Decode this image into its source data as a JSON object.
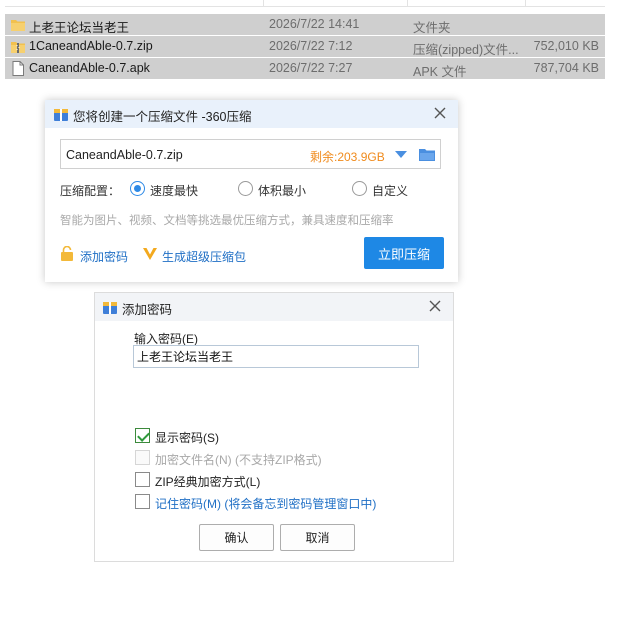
{
  "explorer": {
    "files": [
      {
        "name": "上老王论坛当老王",
        "date": "2026/7/22 14:41",
        "type": "文件夹",
        "size": "",
        "icon": "folder-icon",
        "selected": true
      },
      {
        "name": "1CaneandAble-0.7.zip",
        "date": "2026/7/22 7:12",
        "type": "压缩(zipped)文件...",
        "size": "752,010 KB",
        "icon": "zip-folder-icon",
        "selected": true
      },
      {
        "name": "CaneandAble-0.7.apk",
        "date": "2026/7/22 7:27",
        "type": "APK 文件",
        "size": "787,704 KB",
        "icon": "document-icon",
        "selected": true
      }
    ]
  },
  "compress_dialog": {
    "title": "您将创建一个压缩文件 -360压缩",
    "filename": "CaneandAble-0.7.zip",
    "free_space": "剩余:203.9GB",
    "config_label": "压缩配置：",
    "options": [
      "速度最快",
      "体积最小",
      "自定义"
    ],
    "selected_option": "速度最快",
    "hint": "智能为图片、视频、文档等挑选最优压缩方式，兼具速度和压缩率",
    "add_password_link": "添加密码",
    "super_pack_link": "生成超级压缩包",
    "compress_button": "立即压缩",
    "accent_color": "#1e88e5"
  },
  "password_dialog": {
    "title": "添加密码",
    "input_label": "输入密码(E)",
    "password_value": "上老王论坛当老王",
    "checkboxes": [
      {
        "label": "显示密码(S)",
        "checked": true,
        "disabled": false
      },
      {
        "label": "加密文件名(N) (不支持ZIP格式)",
        "checked": false,
        "disabled": true
      },
      {
        "label": "ZIP经典加密方式(L)",
        "checked": false,
        "disabled": false
      },
      {
        "label": "记住密码(M) (将会备忘到密码管理窗口中)",
        "checked": false,
        "disabled": false
      }
    ],
    "ok_button": "确认",
    "cancel_button": "取消"
  }
}
